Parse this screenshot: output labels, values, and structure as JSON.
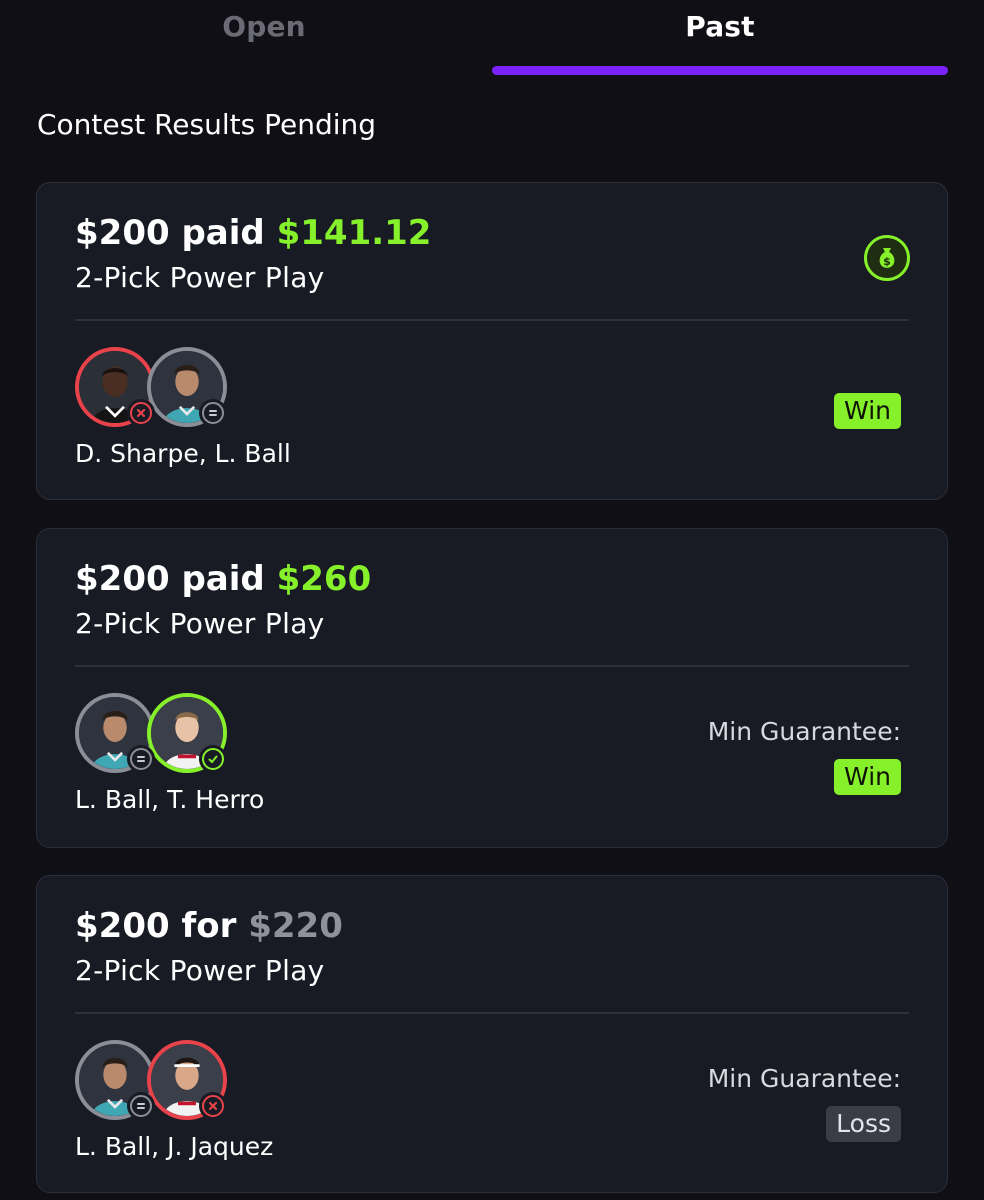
{
  "tabs": {
    "open": "Open",
    "past": "Past",
    "active": "Past"
  },
  "section_title": "Contest Results Pending",
  "colors": {
    "accent_purple": "#7b23ff",
    "green": "#86f02a",
    "red": "#e8424a",
    "gray": "#8b8d97"
  },
  "cards": [
    {
      "stake": "$200 paid",
      "payout": "$141.12",
      "payout_color": "green",
      "type": "2-Pick Power Play",
      "icon": "money-bag-icon",
      "players": "D. Sharpe, L. Ball",
      "picks": [
        {
          "player": "D. Sharpe",
          "status": "loss"
        },
        {
          "player": "L. Ball",
          "status": "push"
        }
      ],
      "min_guarantee": "",
      "result": "Win"
    },
    {
      "stake": "$200 paid",
      "payout": "$260",
      "payout_color": "green",
      "type": "2-Pick Power Play",
      "players": "L. Ball, T. Herro",
      "picks": [
        {
          "player": "L. Ball",
          "status": "push"
        },
        {
          "player": "T. Herro",
          "status": "win"
        }
      ],
      "min_guarantee": "Min Guarantee:",
      "result": "Win"
    },
    {
      "stake": "$200 for",
      "payout": "$220",
      "payout_color": "gray",
      "type": "2-Pick Power Play",
      "players": "L. Ball, J. Jaquez",
      "picks": [
        {
          "player": "L. Ball",
          "status": "push"
        },
        {
          "player": "J. Jaquez",
          "status": "loss"
        }
      ],
      "min_guarantee": "Min Guarantee:",
      "result": "Loss"
    }
  ]
}
